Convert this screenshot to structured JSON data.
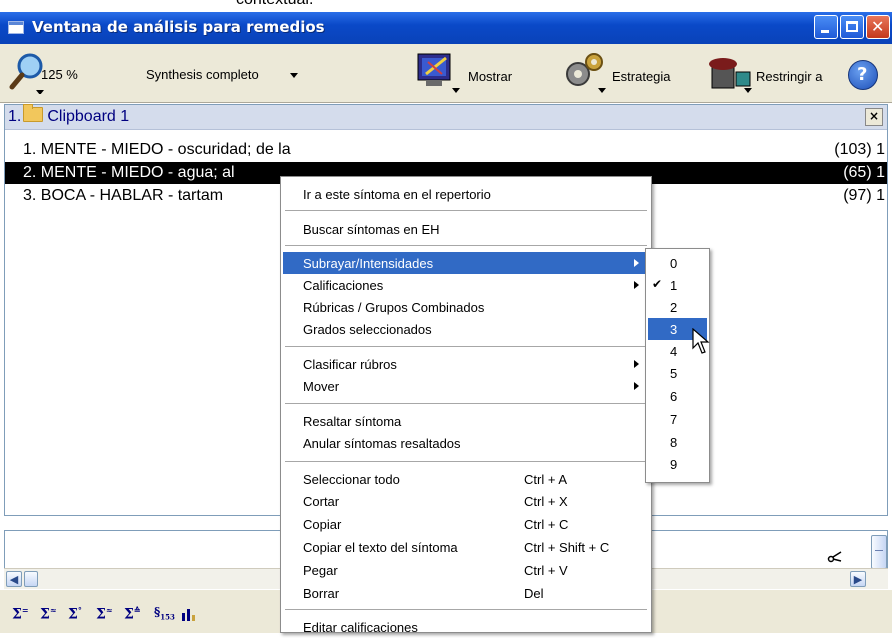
{
  "top_caption": "contextual.",
  "window": {
    "title": "Ventana de análisis para remedios"
  },
  "toolbar": {
    "zoom": "125 %",
    "synthesis": "Synthesis completo",
    "show": "Mostrar",
    "strategy": "Estrategia",
    "restrict": "Restringir a",
    "help": "?"
  },
  "clipboard": {
    "number": "1.",
    "title": "Clipboard 1",
    "close": "×",
    "rows": [
      {
        "text": "1. MENTE - MIEDO - oscuridad; de la",
        "count": "(103) 1"
      },
      {
        "text": "2. MENTE - MIEDO - agua; al",
        "count": "(65) 1"
      },
      {
        "text": "3. BOCA - HABLAR - tartam",
        "count": "(97) 1"
      }
    ]
  },
  "context_menu": {
    "items": [
      {
        "label": "Ir a este síntoma en el repertorio",
        "shortcut": ""
      },
      {
        "label": "Buscar síntomas en EH",
        "shortcut": ""
      },
      {
        "label": "Subrayar/Intensidades",
        "shortcut": ""
      },
      {
        "label": "Calificaciones",
        "shortcut": ""
      },
      {
        "label": "Rúbricas / Grupos Combinados",
        "shortcut": ""
      },
      {
        "label": "Grados seleccionados",
        "shortcut": ""
      },
      {
        "label": "Clasificar rúbros",
        "shortcut": ""
      },
      {
        "label": "Mover",
        "shortcut": ""
      },
      {
        "label": "Resaltar síntoma",
        "shortcut": ""
      },
      {
        "label": "Anular síntomas resaltados",
        "shortcut": ""
      },
      {
        "label": "Seleccionar todo",
        "shortcut": "Ctrl + A"
      },
      {
        "label": "Cortar",
        "shortcut": "Ctrl + X"
      },
      {
        "label": "Copiar",
        "shortcut": "Ctrl + C"
      },
      {
        "label": "Copiar el texto del síntoma",
        "shortcut": "Ctrl + Shift + C"
      },
      {
        "label": "Pegar",
        "shortcut": "Ctrl + V"
      },
      {
        "label": "Borrar",
        "shortcut": "Del"
      },
      {
        "label": "Editar calificaciones",
        "shortcut": ""
      }
    ]
  },
  "submenu": {
    "items": [
      "0",
      "1",
      "2",
      "3",
      "4",
      "5",
      "6",
      "7",
      "8",
      "9"
    ],
    "checked": "1",
    "highlighted": "3"
  },
  "bottom_toolbar": {
    "icons": [
      "sum-icon",
      "sum-icon",
      "sum-icon",
      "sum-icon",
      "sum-icon",
      "count-153-icon",
      "bar-chart-icon"
    ]
  },
  "colors": {
    "titlebar": "#0a49c8",
    "highlight": "#316ac5",
    "selected_row": "#000000"
  }
}
